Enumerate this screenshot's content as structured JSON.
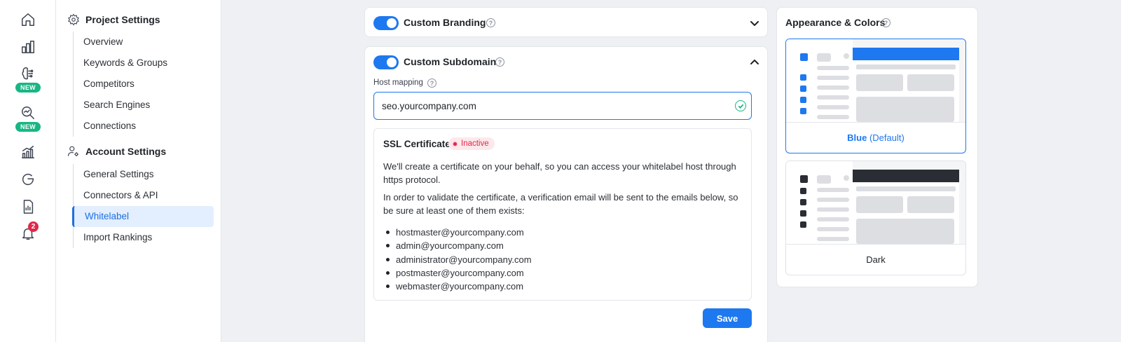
{
  "rail": {
    "new_badge": "NEW",
    "notification_count": "2"
  },
  "sidebar": {
    "project_settings": {
      "title": "Project Settings",
      "items": [
        "Overview",
        "Keywords & Groups",
        "Competitors",
        "Search Engines",
        "Connections"
      ]
    },
    "account_settings": {
      "title": "Account Settings",
      "items": [
        "General Settings",
        "Connectors & API",
        "Whitelabel",
        "Import Rankings"
      ]
    },
    "active_item": "Whitelabel"
  },
  "branding": {
    "title": "Custom Branding",
    "help": "?"
  },
  "subdomain": {
    "title": "Custom Subdomain",
    "help": "?",
    "host_label": "Host mapping",
    "host_value": "seo.yourcompany.com",
    "ssl": {
      "title": "SSL Certificate",
      "status": "Inactive",
      "para1": "We'll create a certificate on your behalf, so you can access your whitelabel host through https protocol.",
      "para2": "In order to validate the certificate, a verification email will be sent to the emails below, so be sure at least one of them exists:",
      "emails": [
        "hostmaster@yourcompany.com",
        "admin@yourcompany.com",
        "administrator@yourcompany.com",
        "postmaster@yourcompany.com",
        "webmaster@yourcompany.com"
      ]
    },
    "save_label": "Save"
  },
  "appearance": {
    "title": "Appearance & Colors",
    "help": "?",
    "themes": [
      {
        "name": "Blue",
        "suffix": "(Default)",
        "accent": "#1e78f0",
        "selected": true
      },
      {
        "name": "Dark",
        "suffix": "",
        "accent": "#2a2d33",
        "selected": false
      }
    ]
  },
  "colors": {
    "primary": "#1e78f0",
    "success": "#19b684",
    "danger": "#e0284a"
  }
}
